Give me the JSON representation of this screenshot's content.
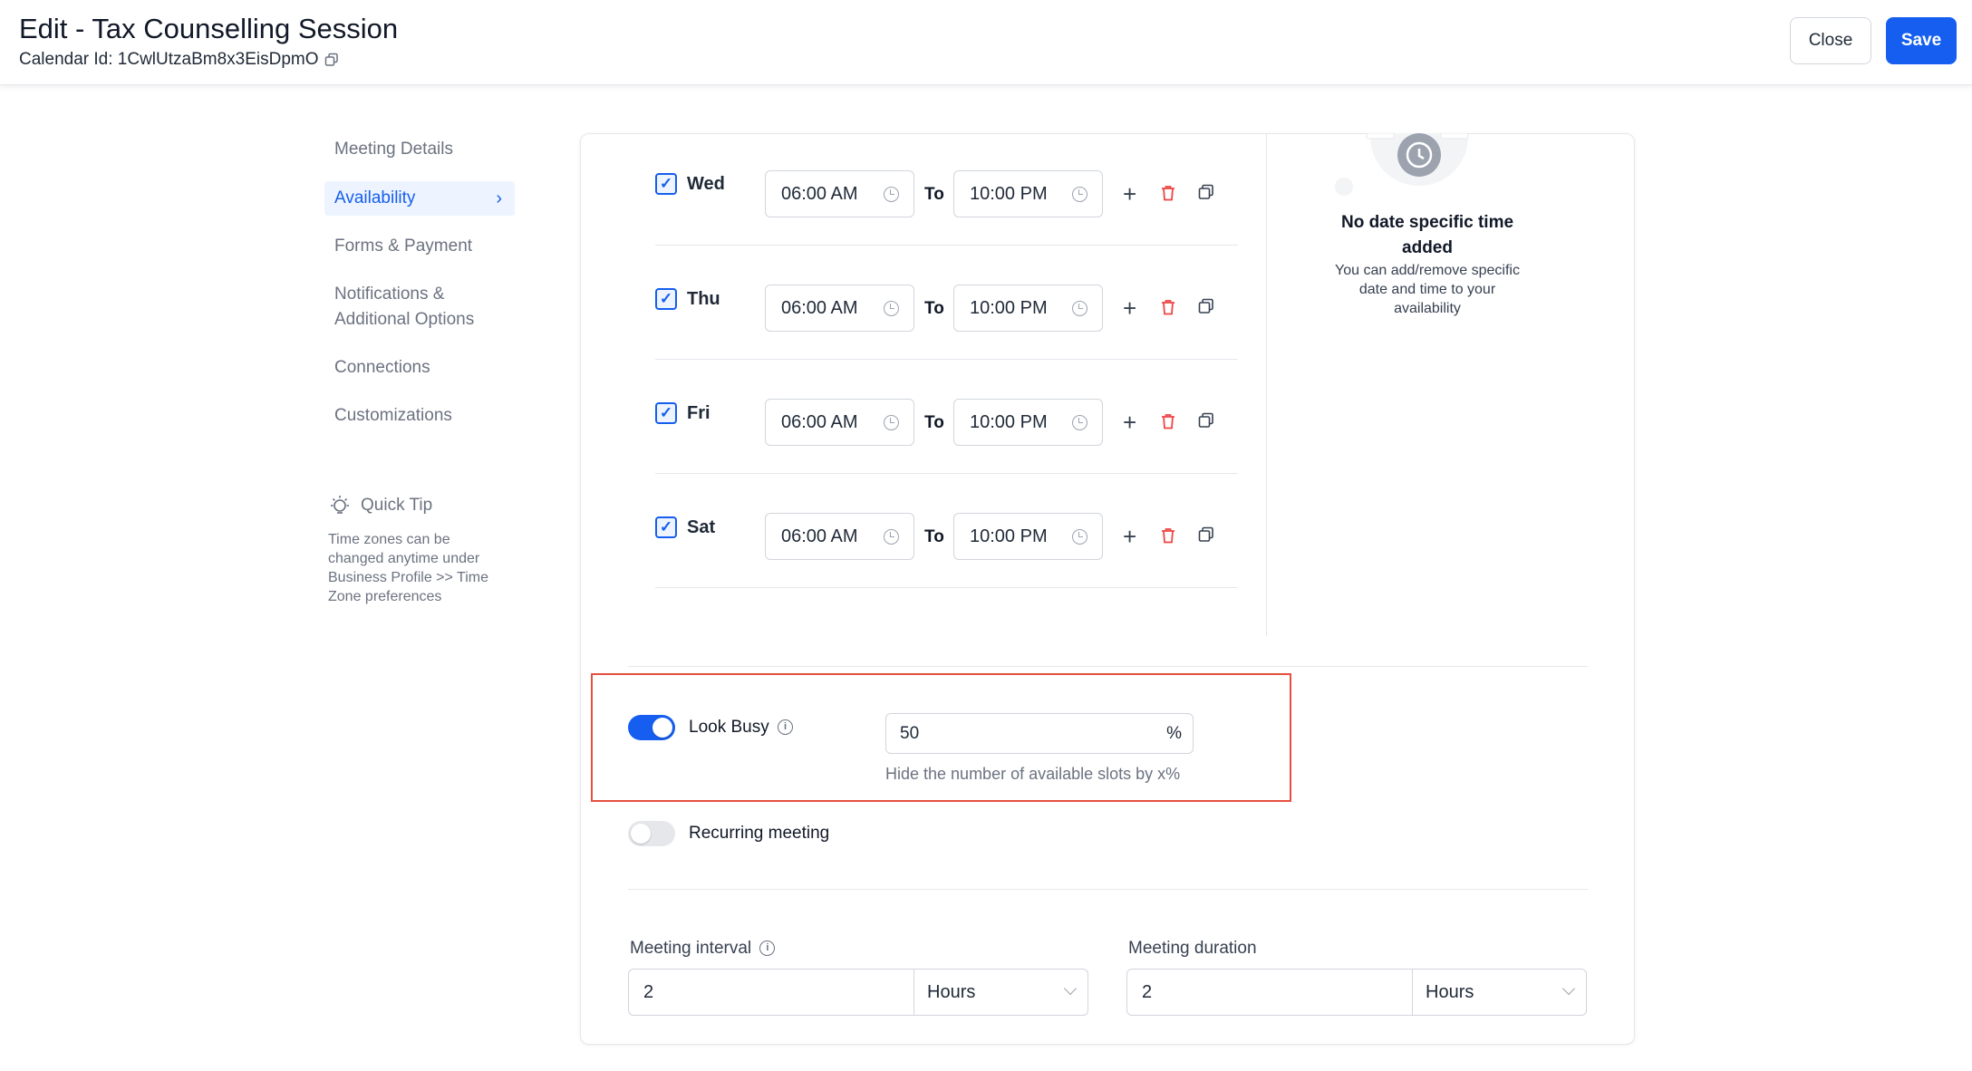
{
  "header": {
    "title": "Edit - Tax Counselling Session",
    "calendar_id": "Calendar Id: 1CwlUtzaBm8x3EisDpmO",
    "close_label": "Close",
    "save_label": "Save"
  },
  "nav": {
    "items": [
      {
        "label": "Meeting Details"
      },
      {
        "label": "Availability"
      },
      {
        "label": "Forms & Payment"
      },
      {
        "label": "Notifications &"
      },
      {
        "label": "Additional Options"
      },
      {
        "label": "Connections"
      },
      {
        "label": "Customizations"
      }
    ]
  },
  "quick_tip": {
    "title": "Quick Tip",
    "body": "Time zones can be changed anytime under Business Profile >> Time Zone preferences"
  },
  "availability": {
    "to_label": "To",
    "days": [
      {
        "day": "Wed",
        "from": "06:00 AM",
        "to": "10:00 PM",
        "checked": true
      },
      {
        "day": "Thu",
        "from": "06:00 AM",
        "to": "10:00 PM",
        "checked": true
      },
      {
        "day": "Fri",
        "from": "06:00 AM",
        "to": "10:00 PM",
        "checked": true
      },
      {
        "day": "Sat",
        "from": "06:00 AM",
        "to": "10:00 PM",
        "checked": true
      }
    ]
  },
  "date_specific": {
    "title": "No date specific time added",
    "desc": "You can add/remove specific date and time to your availability"
  },
  "look_busy": {
    "label": "Look Busy",
    "enabled": true,
    "value": "50",
    "unit": "%",
    "hint": "Hide the number of available slots by x%"
  },
  "recurring": {
    "label": "Recurring meeting",
    "enabled": false
  },
  "meeting_interval": {
    "label": "Meeting interval",
    "value": "2",
    "unit": "Hours"
  },
  "meeting_duration": {
    "label": "Meeting duration",
    "value": "2",
    "unit": "Hours"
  },
  "colors": {
    "accent": "#155eef",
    "danger": "#ef4444",
    "highlight_border": "#e5503e"
  }
}
